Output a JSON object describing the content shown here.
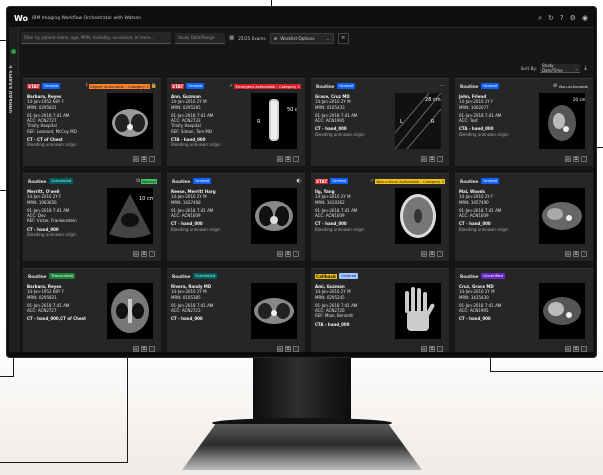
{
  "app": {
    "logo": "Wo",
    "title": "IBM Imaging Workflow Orchestrator with Watson"
  },
  "top_icons": [
    "search-icon",
    "refresh-icon",
    "help-icon",
    "settings-icon",
    "user-icon"
  ],
  "rail": {
    "label": "UNREAD EXAMS 6"
  },
  "filter": {
    "search_placeholder": "Filter by patient name, age, MRN, modality, accession, or more...",
    "date_placeholder": "Study Date/Range",
    "count": "25/25 Exams",
    "worklist_label": "Worklist Options"
  },
  "sort": {
    "label": "Sort By:",
    "value": "Study Date/Time"
  },
  "cards": [
    {
      "priority": "STAT",
      "prio_class": "stat",
      "tag": "Unread",
      "tag_class": "blue",
      "status_icon": "!",
      "status_text": "Urgent Actionable - Category 2",
      "status_class": "orange",
      "lock": "lock-icon",
      "name": "Barbara, Reyes",
      "dob": "14-Jan-1952 68Y F",
      "mrn": "MRN: 0295821",
      "date": "01-Jan-2018 7:41 AM",
      "acc": "ACC: ACN2727",
      "facility": "Trinity Hospital",
      "ref": "REF: Leonard, McCoy MD",
      "exam": "CT - CT of Chest",
      "reason": "Bleeding unknown origin",
      "img": "chest-ct"
    },
    {
      "priority": "STAT",
      "prio_class": "stat",
      "tag": "Unread",
      "tag_class": "blue",
      "status_icon": "✓",
      "status_text": "Emergent Actionable - Category 1",
      "status_class": "red",
      "name": "Ann, Guzman",
      "dob": "14-Jan-2010 2Y M",
      "mrn": "MRN: 0295285",
      "date": "01-Jan-2018 7:41 AM",
      "acc": "ACC: ACN2733",
      "facility": "Trinity Hospital",
      "ref": "REF: Simon, Tam MD",
      "exam": "CTA - hand_000",
      "reason": "Bleeding unknown origin",
      "img": "xray-leg"
    },
    {
      "priority": "Routine",
      "prio_class": "routine",
      "tag": "Unread",
      "tag_class": "blue",
      "status_icon": "⋯",
      "status_text": "",
      "status_class": "plain",
      "name": "Grace, Cruz MD",
      "dob": "14-Jan-2010 2Y M",
      "mrn": "MRN: 0105433",
      "date": "01-Jan-2018 7:41 AM",
      "acc": "ACC: ACN1995",
      "exam": "CT - hand_000",
      "reason": "Bleeding unknown origin",
      "img": "mri-dark"
    },
    {
      "priority": "Routine",
      "prio_class": "routine",
      "tag": "Unread",
      "tag_class": "blue",
      "status_icon": "⊘",
      "status_text": "Non-actionable",
      "status_class": "plain",
      "name": "John, Friend",
      "dob": "14-Jan-2010 2Y F",
      "mrn": "MRN: 1002077",
      "date": "01-Jan-2018 7:41 AM",
      "acc": "ACC: Test",
      "exam": "CTA - hand_000",
      "reason": "Bleeding unknown origin",
      "img": "abdomen-ct"
    },
    {
      "priority": "Routine",
      "prio_class": "routine",
      "tag": "Scheduled",
      "tag_class": "teal",
      "status_icon": "⊙",
      "status_text": "Normal",
      "status_class": "greenbg",
      "name": "Merritt, O'well",
      "dob": "14-Jan-2010 2Y F",
      "mrn": "MRN: 1063656",
      "date": "01-Jan-2018 7:41 AM",
      "acc": "ACC: Dev",
      "ref": "REF: Victor, Frankenstein",
      "exam": "CT - hand_000",
      "reason": "Bleeding unknown origin",
      "img": "ultrasound"
    },
    {
      "priority": "Routine",
      "prio_class": "routine",
      "tag": "Unread",
      "tag_class": "blue",
      "status_icon": "◐",
      "status_text": "",
      "status_class": "plain",
      "name": "Reese, Merritt Harg",
      "dob": "14-Jan-2010 2Y M",
      "mrn": "MRN: 1437468",
      "date": "01-Jan-2018 7:41 AM",
      "acc": "ACC: ACN1009",
      "exam": "CT - hand_000",
      "reason": "Bleeding unknown origin",
      "img": "chest-ct2"
    },
    {
      "priority": "STAT",
      "prio_class": "stat",
      "tag": "Unread",
      "tag_class": "blue",
      "status_icon": "✓",
      "status_text": "Non-critical Actionable - Category 3",
      "status_class": "yellow",
      "name": "Ilg, Yang",
      "dob": "14-Jan-2010 2Y M",
      "mrn": "MRN: 3410362",
      "date": "01-Jan-2018 7:41 AM",
      "acc": "ACC: ACN1009",
      "exam": "CT - hand_000",
      "reason": "Bleeding unknown origin",
      "img": "head-ct"
    },
    {
      "priority": "Routine",
      "prio_class": "routine",
      "tag": "Unread",
      "tag_class": "blue",
      "status_icon": "",
      "status_text": "",
      "status_class": "plain",
      "name": "Mal, Woods",
      "dob": "14-Jan-2010 2Y F",
      "mrn": "MRN: 3457490",
      "date": "01-Jan-2018 7:41 AM",
      "acc": "ACC: ACN1009",
      "exam": "CT - hand_000",
      "reason": "Bleeding unknown origin",
      "img": "abdomen-ct2"
    },
    {
      "priority": "Routine",
      "prio_class": "routine",
      "tag": "Transcribed",
      "tag_class": "green",
      "status_icon": "",
      "status_text": "",
      "status_class": "plain",
      "name": "Barbara, Reyes",
      "dob": "14-Jan-1952 68Y F",
      "mrn": "MRN: 0295821",
      "date": "01-Jan-2018 7:41 AM",
      "acc": "ACC: ACN2727",
      "exam": "CT - hand_000,CT of Chest",
      "reason": "",
      "img": "sinus-ct"
    },
    {
      "priority": "Routine",
      "prio_class": "routine",
      "tag": "Scheduled",
      "tag_class": "teal",
      "status_icon": "",
      "status_text": "",
      "status_class": "plain",
      "name": "Rivera, Randy MD",
      "dob": "14-Jan-2010 2Y M",
      "mrn": "MRN: 0105385",
      "date": "01-Jan-2018 7:41 AM",
      "acc": "ACC: ACN2723",
      "exam": "CT - hand_000",
      "reason": "",
      "img": "chest-ct3"
    },
    {
      "priority": "Callback",
      "prio_class": "callback",
      "tag": "Ordered",
      "tag_class": "ltblue",
      "status_icon": "",
      "status_text": "",
      "status_class": "plain",
      "name": "Ami, Guzman",
      "dob": "14-Jan-2010 2Y M",
      "mrn": "MRN: 0295245",
      "date": "01-Jan-2018 7:41 AM",
      "acc": "ACC: ACN2720",
      "ref": "REF: Mian, Bennett",
      "exam": "CTA - hand_000",
      "reason": "",
      "img": "hand-xray"
    },
    {
      "priority": "Routine",
      "prio_class": "routine",
      "tag": "Unverified",
      "tag_class": "purple",
      "status_icon": "",
      "status_text": "",
      "status_class": "plain",
      "name": "Cruz, Grace MD",
      "dob": "14-Jan-2010 2Y M",
      "mrn": "MRN: 3435430",
      "date": "01-Jan-2018 7:41 AM",
      "acc": "ACC: ACN1995",
      "exam": "CT - hand_000",
      "reason": "",
      "img": "abdomen-ct3"
    }
  ]
}
